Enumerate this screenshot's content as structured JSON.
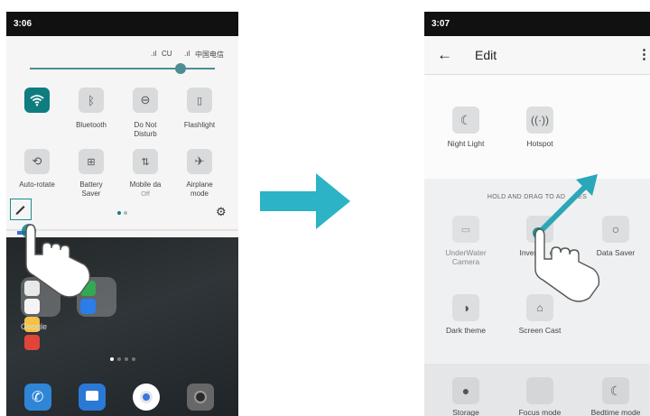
{
  "left_phone": {
    "time": "3:06",
    "carrier1": "CU",
    "carrier2": "中国电信",
    "brightness_level": 0.84,
    "tiles": [
      {
        "label_line1": "Bluetooth",
        "label_line2": "",
        "icon": "bluetooth-icon"
      },
      {
        "label_line1": "Do Not",
        "label_line2": "Disturb",
        "icon": "do-not-disturb-icon"
      },
      {
        "label_line1": "Flashlight",
        "label_line2": "",
        "icon": "flashlight-icon"
      },
      {
        "label_line1": "Auto-rotate",
        "label_line2": "",
        "icon": "auto-rotate-icon"
      },
      {
        "label_line1": "Battery",
        "label_line2": "Saver",
        "icon": "battery-saver-icon"
      },
      {
        "label_line1": "Mobile da",
        "label_line2": "Off",
        "icon": "mobile-data-icon"
      },
      {
        "label_line1": "Airplane",
        "label_line2": "mode",
        "icon": "airplane-icon"
      }
    ],
    "wifi_tile_on": true,
    "accent_color": "#0f7d80",
    "home_folder_label": "Google"
  },
  "right_phone": {
    "time": "3:07",
    "title": "Edit",
    "active_tiles": [
      {
        "label": "Night Light",
        "icon": "night-light-icon"
      },
      {
        "label": "Hotspot",
        "icon": "hotspot-icon"
      }
    ],
    "hold_drag_label": "HOLD AND DRAG TO AD",
    "hold_drag_label_end": "ES",
    "inactive_tiles": [
      {
        "label_line1": "UnderWater",
        "label_line2": "Camera",
        "icon": "underwater-camera-icon"
      },
      {
        "label_line1": "Invert",
        "label_line2": "",
        "label_tail": "ors",
        "icon": "invert-colors-icon"
      },
      {
        "label_line1": "Data Saver",
        "label_line2": "",
        "icon": "data-saver-icon"
      },
      {
        "label_line1": "Dark theme",
        "label_line2": "",
        "icon": "dark-theme-icon"
      },
      {
        "label_line1": "Screen Cast",
        "label_line2": "",
        "icon": "screen-cast-icon"
      }
    ],
    "bottom_tiles": [
      {
        "label": "Storage",
        "icon": "storage-icon"
      },
      {
        "label": "Focus mode",
        "icon": "focus-mode-icon"
      },
      {
        "label": "Bedtime mode",
        "icon": "bedtime-icon"
      }
    ],
    "arrow_color": "#2aa7b8"
  },
  "transition_arrow_color": "#2cb3c6"
}
